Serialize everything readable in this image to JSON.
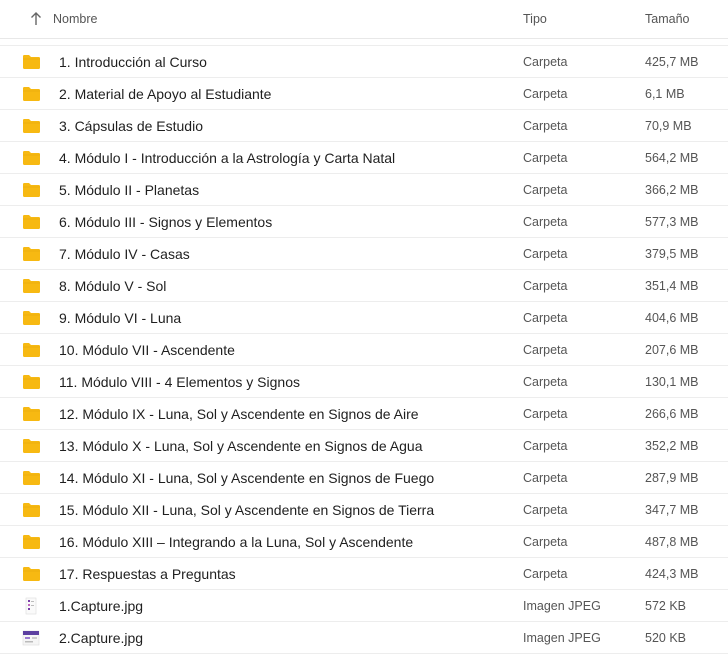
{
  "header": {
    "name": "Nombre",
    "type": "Tipo",
    "size": "Tamaño",
    "sort_icon": "arrow-up-icon"
  },
  "colors": {
    "folder": "#f7b912",
    "folder_dark": "#e6a30b"
  },
  "files": [
    {
      "name": "1. Introducción al Curso",
      "type": "Carpeta",
      "size": "425,7 MB",
      "kind": "folder"
    },
    {
      "name": "2. Material de Apoyo al Estudiante",
      "type": "Carpeta",
      "size": "6,1 MB",
      "kind": "folder"
    },
    {
      "name": "3. Cápsulas de Estudio",
      "type": "Carpeta",
      "size": "70,9 MB",
      "kind": "folder"
    },
    {
      "name": "4. Módulo I - Introducción a la Astrología y Carta Natal",
      "type": "Carpeta",
      "size": "564,2 MB",
      "kind": "folder"
    },
    {
      "name": "5. Módulo II - Planetas",
      "type": "Carpeta",
      "size": "366,2 MB",
      "kind": "folder"
    },
    {
      "name": "6. Módulo III - Signos y Elementos",
      "type": "Carpeta",
      "size": "577,3 MB",
      "kind": "folder"
    },
    {
      "name": "7. Módulo IV - Casas",
      "type": "Carpeta",
      "size": "379,5 MB",
      "kind": "folder"
    },
    {
      "name": "8. Módulo V - Sol",
      "type": "Carpeta",
      "size": "351,4 MB",
      "kind": "folder"
    },
    {
      "name": "9. Módulo VI - Luna",
      "type": "Carpeta",
      "size": "404,6 MB",
      "kind": "folder"
    },
    {
      "name": "10. Módulo VII - Ascendente",
      "type": "Carpeta",
      "size": "207,6 MB",
      "kind": "folder"
    },
    {
      "name": "11. Módulo VIII - 4 Elementos y Signos",
      "type": "Carpeta",
      "size": "130,1 MB",
      "kind": "folder"
    },
    {
      "name": "12. Módulo IX - Luna, Sol y Ascendente en Signos de Aire",
      "type": "Carpeta",
      "size": "266,6 MB",
      "kind": "folder"
    },
    {
      "name": "13. Módulo X - Luna, Sol y Ascendente en Signos de Agua",
      "type": "Carpeta",
      "size": "352,2 MB",
      "kind": "folder"
    },
    {
      "name": "14. Módulo XI - Luna, Sol y Ascendente en Signos de Fuego",
      "type": "Carpeta",
      "size": "287,9 MB",
      "kind": "folder"
    },
    {
      "name": "15. Módulo XII - Luna, Sol y Ascendente en Signos de Tierra",
      "type": "Carpeta",
      "size": "347,7 MB",
      "kind": "folder"
    },
    {
      "name": "16. Módulo XIII – Integrando a la Luna, Sol y Ascendente",
      "type": "Carpeta",
      "size": "487,8 MB",
      "kind": "folder"
    },
    {
      "name": "17. Respuestas a Preguntas",
      "type": "Carpeta",
      "size": "424,3 MB",
      "kind": "folder"
    },
    {
      "name": "1.Capture.jpg",
      "type": "Imagen JPEG",
      "size": "572 KB",
      "kind": "image1"
    },
    {
      "name": "2.Capture.jpg",
      "type": "Imagen JPEG",
      "size": "520 KB",
      "kind": "image2"
    }
  ]
}
